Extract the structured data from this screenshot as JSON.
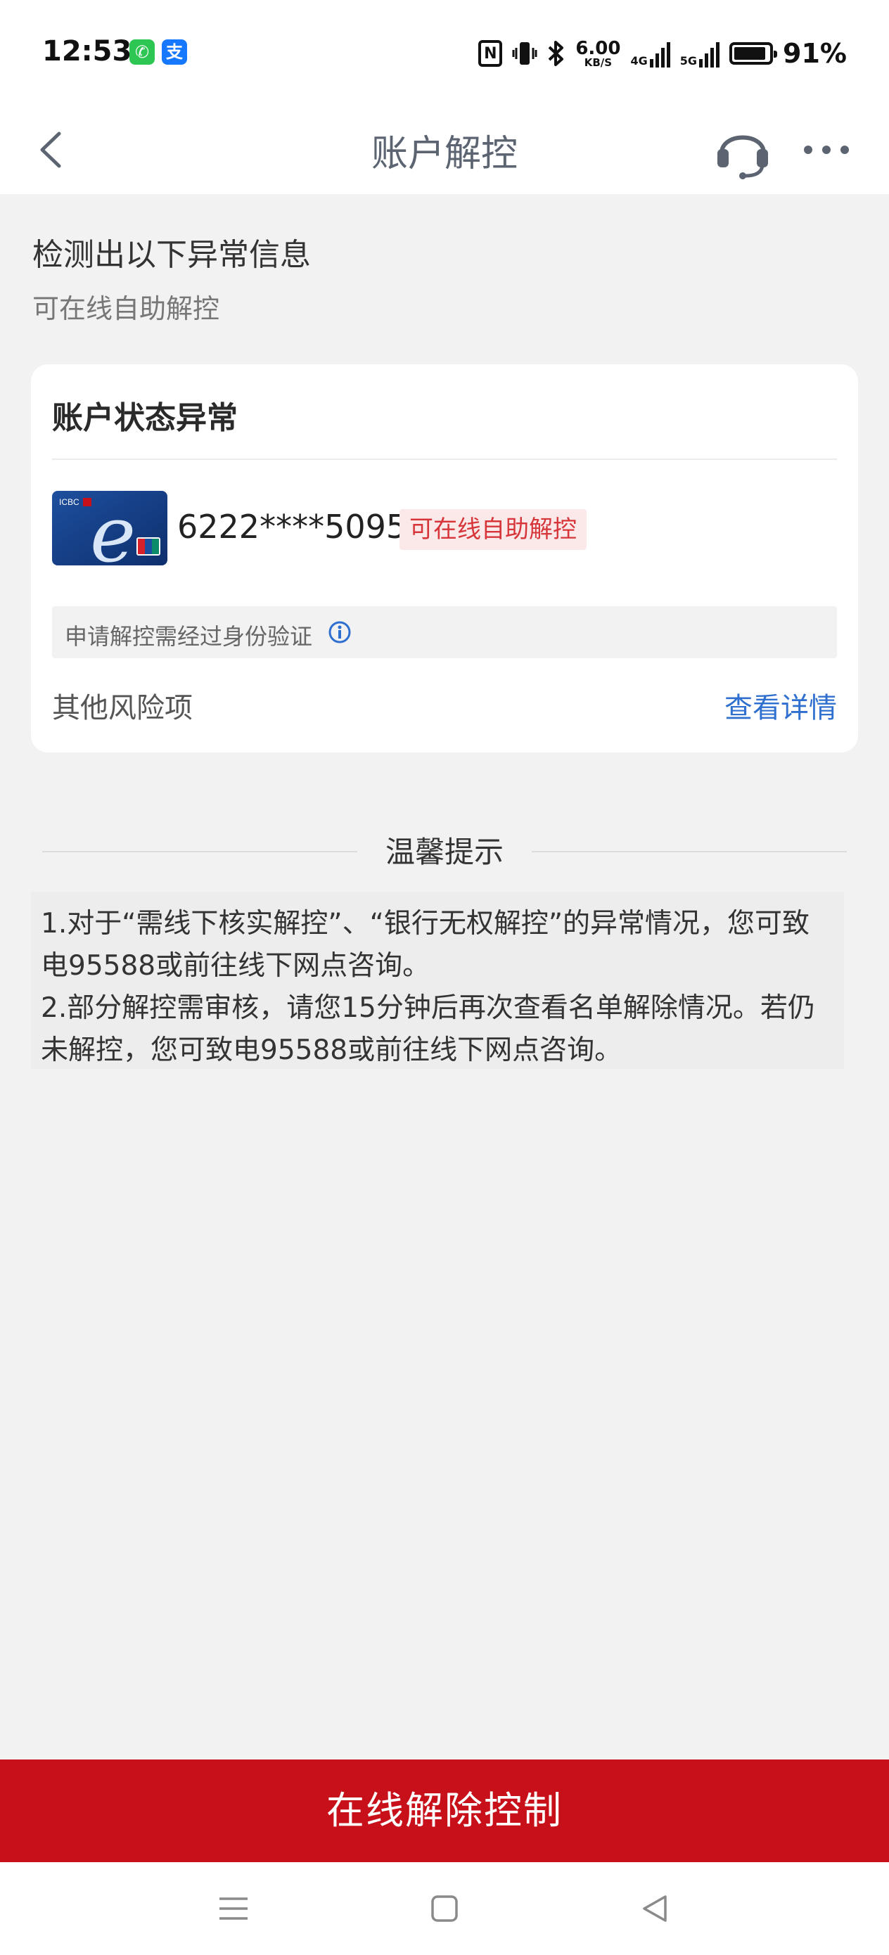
{
  "status_bar": {
    "time": "12:53",
    "net_speed_value": "6.00",
    "net_speed_unit": "KB/S",
    "net1_label": "4G",
    "net2_label": "5G",
    "battery_text": "91%",
    "battery_level": 0.91,
    "wechat_glyph": "✆",
    "alipay_glyph": "支"
  },
  "nav": {
    "title": "账户解控"
  },
  "intro": {
    "title": "检测出以下异常信息",
    "subtitle": "可在线自助解控"
  },
  "card": {
    "title": "账户状态异常",
    "card_number": "6222****5095",
    "status_tag": "可在线自助解控",
    "verify_notice": "申请解控需经过身份验证",
    "other_risk_label": "其他风险项",
    "view_detail_label": "查看详情",
    "bank_card_brand_text": "ICBC",
    "bank_card_letter": "e"
  },
  "tips": {
    "title": "温馨提示",
    "items": [
      "1.对于“需线下核实解控”、“银行无权解控”的异常情况，您可致电95588或前往线下网点咨询。",
      "2.部分解控需审核，请您15分钟后再次查看名单解除情况。若仍未解控，您可致电95588或前往线下网点咨询。"
    ]
  },
  "primary_button": {
    "label": "在线解除控制"
  },
  "colors": {
    "brand_red": "#c8101a",
    "link_blue": "#2f6fcf",
    "tag_red": "#d6363a",
    "page_bg": "#f2f2f3"
  },
  "icons": {
    "back": "chevron-left-icon",
    "service": "headset-icon",
    "more": "more-horizontal-icon",
    "info": "info-icon",
    "nfc": "nfc-icon",
    "vibrate": "vibrate-icon",
    "bluetooth": "bluetooth-icon",
    "menu": "menu-icon",
    "home": "home-icon",
    "back_nav": "triangle-back-icon"
  }
}
